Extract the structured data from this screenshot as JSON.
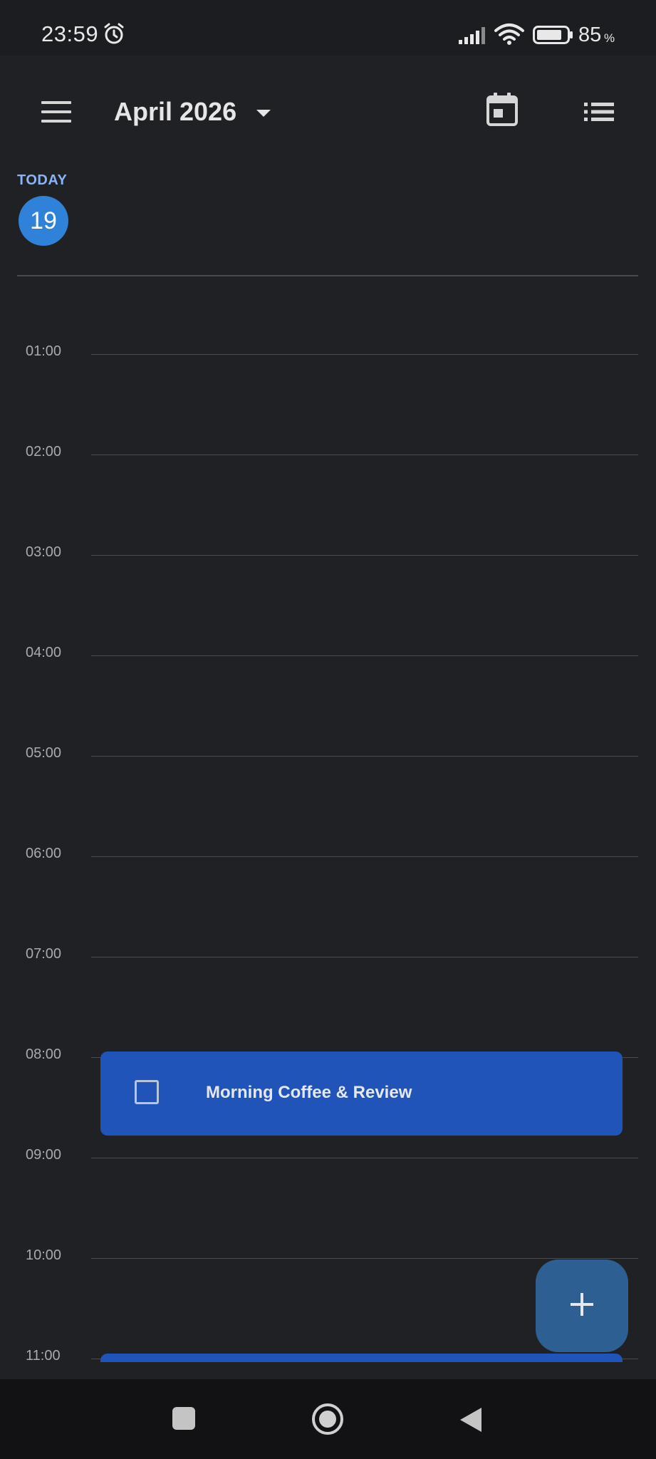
{
  "status_bar": {
    "time": "23:59",
    "battery_percent": "85",
    "battery_sign": "%",
    "battery_level": 0.85
  },
  "app_bar": {
    "month_title": "April 2026"
  },
  "day_header": {
    "today_label": "TODAY",
    "day_number": "19"
  },
  "timeline": {
    "hours": [
      "01:00",
      "02:00",
      "03:00",
      "04:00",
      "05:00",
      "06:00",
      "07:00",
      "08:00",
      "09:00",
      "10:00",
      "11:00"
    ]
  },
  "events": [
    {
      "title": "Morning Coffee & Review",
      "checked": false,
      "color": "#2154b8"
    },
    {
      "title": "",
      "checked": false,
      "color": "#2154b8"
    }
  ],
  "colors": {
    "background": "#202124",
    "accent": "#2f82d8",
    "event": "#2154b8",
    "fab": "#2d5f92",
    "today_label": "#8ab4f8"
  },
  "icons": {
    "status": [
      "alarm-icon",
      "signal-icon",
      "wifi-icon",
      "battery-icon"
    ],
    "app_bar": [
      "menu-icon",
      "dropdown-icon",
      "calendar-view-icon",
      "list-view-icon"
    ],
    "fab": "add-icon",
    "nav": [
      "recents-icon",
      "home-icon",
      "back-icon"
    ]
  }
}
